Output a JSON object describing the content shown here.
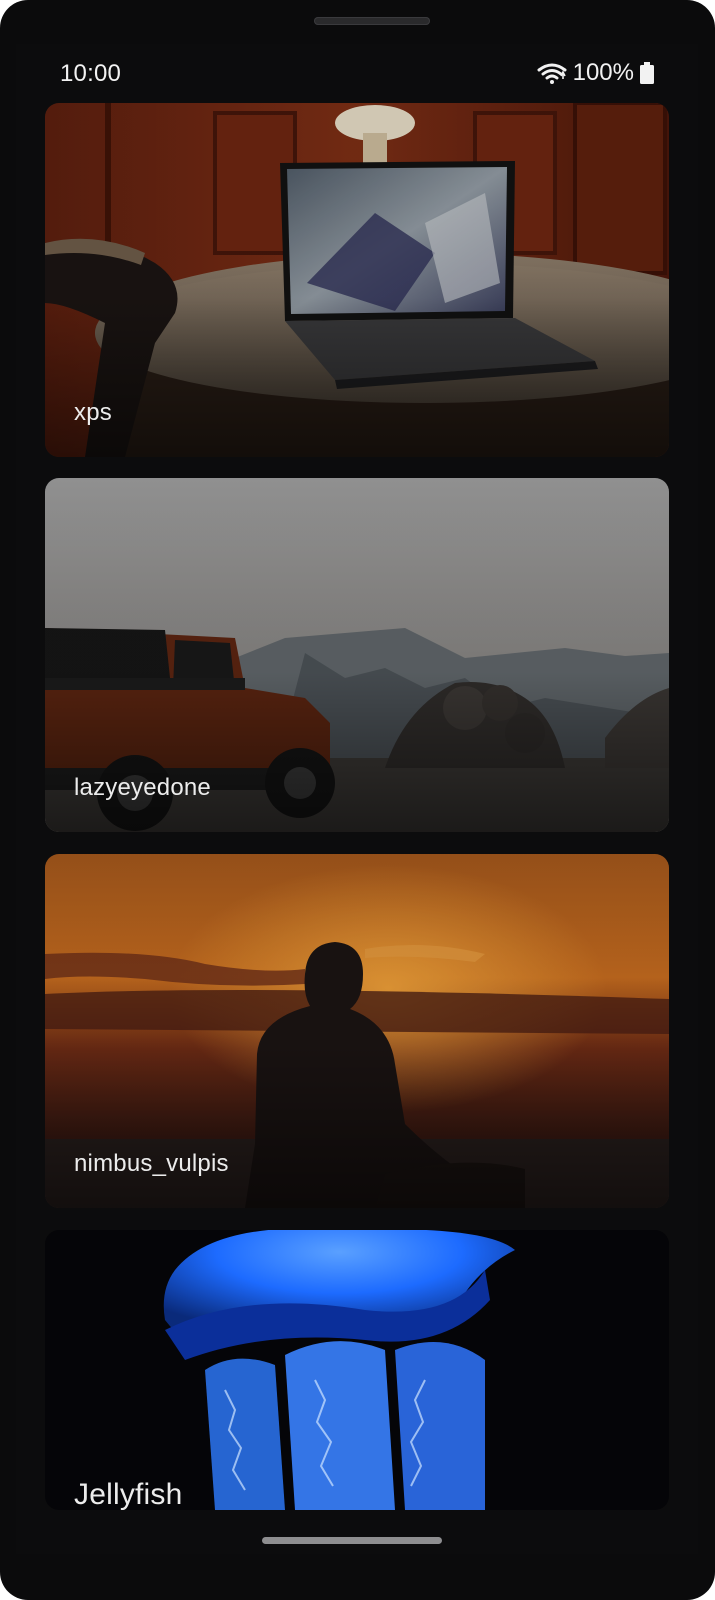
{
  "status_bar": {
    "time": "10:00",
    "battery": "100%",
    "icons": [
      "wifi-icon",
      "battery-icon"
    ]
  },
  "wallpapers": [
    {
      "name": "xps",
      "subject": "laptop-on-table"
    },
    {
      "name": "lazyeyedone",
      "subject": "jeep-in-desert"
    },
    {
      "name": "nimbus_vulpis",
      "subject": "sunset-silhouette"
    },
    {
      "name": "Jellyfish",
      "subject": "blue-jellyfish"
    }
  ],
  "colors": {
    "background": "#0c0c0d",
    "text": "#ececec",
    "sunset": "#c36a1e",
    "jellyfish": "#1d6bff"
  }
}
